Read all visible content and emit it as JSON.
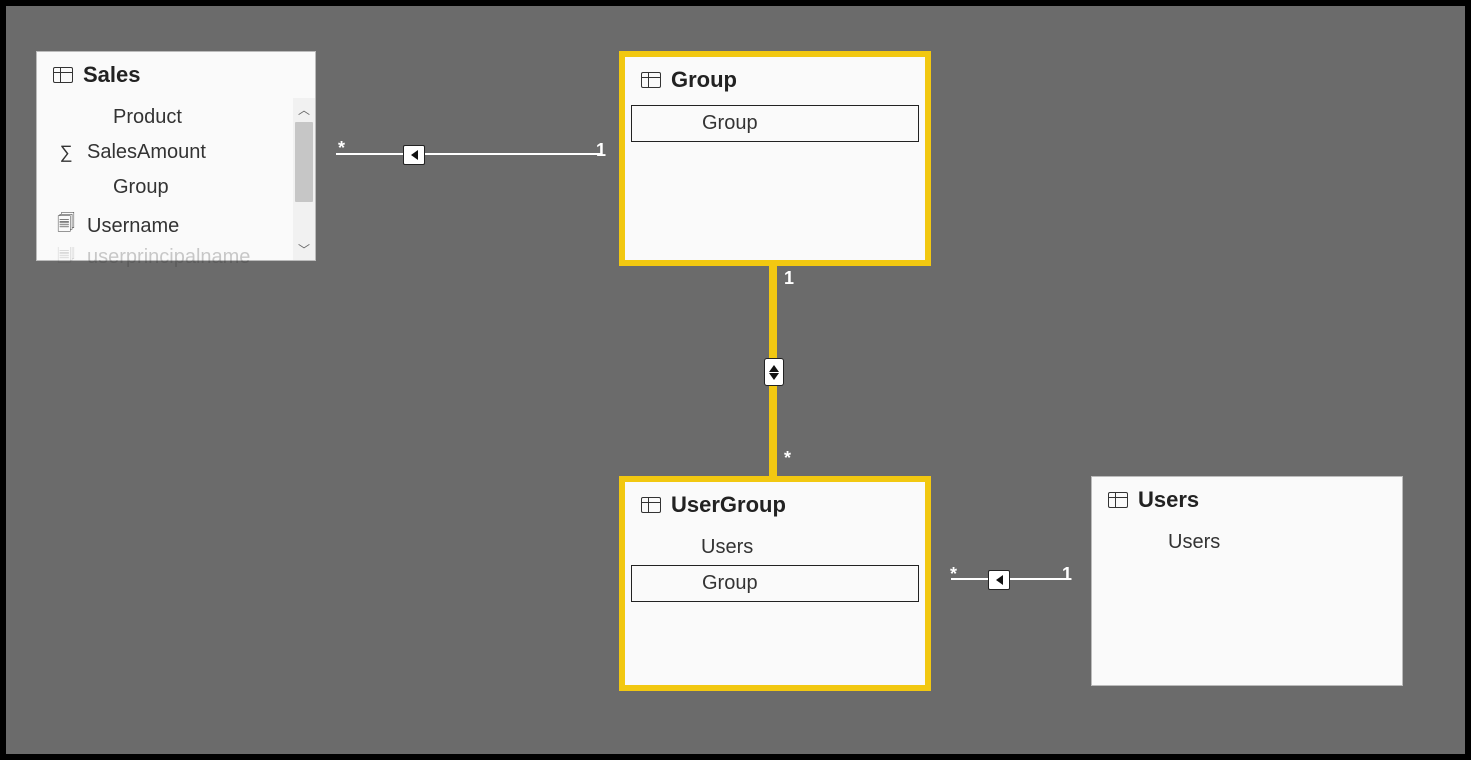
{
  "tables": {
    "sales": {
      "title": "Sales",
      "fields": {
        "product": "Product",
        "salesAmount": "SalesAmount",
        "group": "Group",
        "username": "Username",
        "upn": "userprincipalname"
      }
    },
    "group": {
      "title": "Group",
      "fields": {
        "group": "Group"
      }
    },
    "userGroup": {
      "title": "UserGroup",
      "fields": {
        "users": "Users",
        "group": "Group"
      }
    },
    "users": {
      "title": "Users",
      "fields": {
        "users": "Users"
      }
    }
  },
  "cardinality": {
    "one": "1",
    "many": "*"
  },
  "relationships": [
    {
      "from": "Sales",
      "to": "Group",
      "fromCard": "*",
      "toCard": "1",
      "filterDirection": "single"
    },
    {
      "from": "Group",
      "to": "UserGroup",
      "fromCard": "1",
      "toCard": "*",
      "filterDirection": "both"
    },
    {
      "from": "UserGroup",
      "to": "Users",
      "fromCard": "*",
      "toCard": "1",
      "filterDirection": "single"
    }
  ]
}
